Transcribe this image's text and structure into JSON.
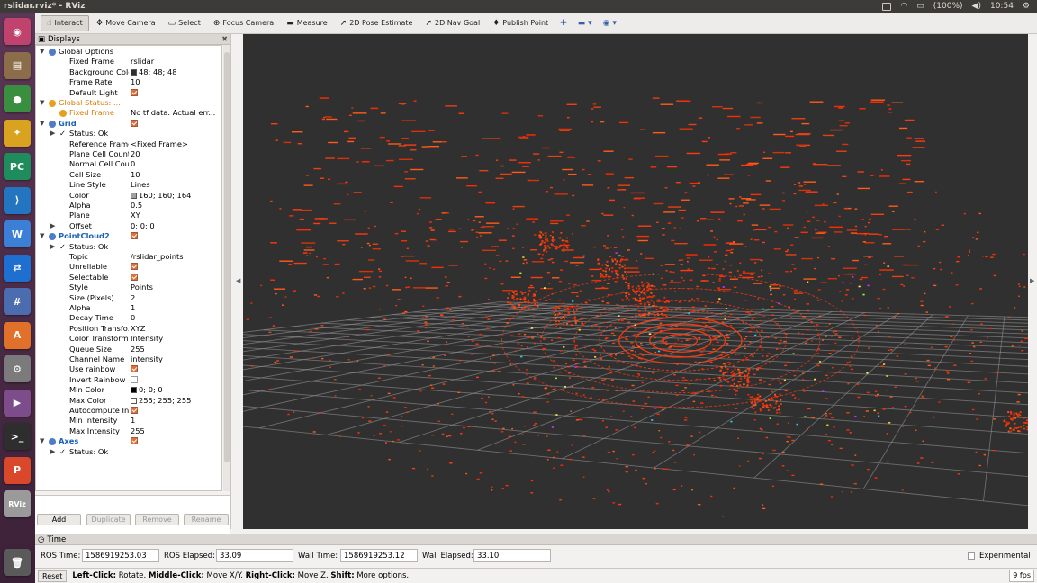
{
  "window": {
    "title": "rslidar.rviz* - RViz"
  },
  "system": {
    "battery": "(100%)",
    "time": "10:54"
  },
  "launcher": [
    {
      "name": "ubuntu-dash",
      "glyph": "◉",
      "color": "#c0436e"
    },
    {
      "name": "files",
      "glyph": "▤",
      "color": "#8c6d4a"
    },
    {
      "name": "chrome",
      "glyph": "●",
      "color": "#3a8e3f"
    },
    {
      "name": "inkscape",
      "glyph": "✦",
      "color": "#d9a31f"
    },
    {
      "name": "pycharm",
      "glyph": "PC",
      "color": "#1f8c5c"
    },
    {
      "name": "vscode",
      "glyph": "⟩",
      "color": "#2475c1"
    },
    {
      "name": "wps-writer",
      "glyph": "W",
      "color": "#3b7fd6"
    },
    {
      "name": "teamviewer",
      "glyph": "⇄",
      "color": "#1f6fd1"
    },
    {
      "name": "monodevelop",
      "glyph": "#",
      "color": "#4b6db0"
    },
    {
      "name": "software-center",
      "glyph": "A",
      "color": "#e0702a"
    },
    {
      "name": "system-settings",
      "glyph": "⚙",
      "color": "#7b7b7b"
    },
    {
      "name": "video-player",
      "glyph": "▶",
      "color": "#7d4d8b"
    },
    {
      "name": "terminal",
      "glyph": ">_",
      "color": "#2e2e2e"
    },
    {
      "name": "wps-presentation",
      "glyph": "P",
      "color": "#d9482b"
    },
    {
      "name": "rviz",
      "glyph": "RViz",
      "color": "#9a9a9a"
    },
    {
      "name": "trash",
      "glyph": "🗑",
      "color": "#5a5a5a"
    }
  ],
  "toolbar": {
    "tools": [
      {
        "id": "interact",
        "label": "Interact",
        "icon": "☝",
        "active": true
      },
      {
        "id": "move-camera",
        "label": "Move Camera",
        "icon": "✥",
        "active": false
      },
      {
        "id": "select",
        "label": "Select",
        "icon": "▭",
        "active": false
      },
      {
        "id": "focus-camera",
        "label": "Focus Camera",
        "icon": "⊕",
        "active": false
      },
      {
        "id": "measure",
        "label": "Measure",
        "icon": "▬",
        "active": false
      },
      {
        "id": "2d-pose-estimate",
        "label": "2D Pose Estimate",
        "icon": "➚",
        "active": false
      },
      {
        "id": "2d-nav-goal",
        "label": "2D Nav Goal",
        "icon": "➚",
        "active": false
      },
      {
        "id": "publish-point",
        "label": "Publish Point",
        "icon": "♦",
        "active": false
      }
    ]
  },
  "displays": {
    "title": "Displays",
    "rows": [
      {
        "depth": 1,
        "arrow": "▼",
        "label": "Global Options",
        "icon": "#4f7cc4",
        "kind": "group-plain"
      },
      {
        "depth": 2,
        "label": "Fixed Frame",
        "value": "rslidar"
      },
      {
        "depth": 2,
        "label": "Background Color",
        "value": "48; 48; 48",
        "swatch": "#303030"
      },
      {
        "depth": 2,
        "label": "Frame Rate",
        "value": "10"
      },
      {
        "depth": 2,
        "label": "Default Light",
        "check": true
      },
      {
        "depth": 1,
        "arrow": "▼",
        "label": "Global Status: ...",
        "icon": "#e6a01c",
        "kind": "warn"
      },
      {
        "depth": 2,
        "label": "Fixed Frame",
        "value": "No tf data.  Actual err...",
        "icon": "#e6a01c",
        "kind": "warn"
      },
      {
        "depth": 1,
        "arrow": "▼",
        "label": "Grid",
        "icon": "#4f7cc4",
        "kind": "group",
        "check": true
      },
      {
        "depth": 2,
        "arrow": "▶",
        "label": "Status: Ok",
        "tick": true
      },
      {
        "depth": 2,
        "label": "Reference Frame",
        "value": "<Fixed Frame>"
      },
      {
        "depth": 2,
        "label": "Plane Cell Count",
        "value": "20"
      },
      {
        "depth": 2,
        "label": "Normal Cell Count",
        "value": "0"
      },
      {
        "depth": 2,
        "label": "Cell Size",
        "value": "10"
      },
      {
        "depth": 2,
        "label": "Line Style",
        "value": "Lines"
      },
      {
        "depth": 2,
        "label": "Color",
        "value": "160; 160; 164",
        "swatch": "#a0a0a4"
      },
      {
        "depth": 2,
        "label": "Alpha",
        "value": "0.5"
      },
      {
        "depth": 2,
        "label": "Plane",
        "value": "XY"
      },
      {
        "depth": 2,
        "arrow": "▶",
        "label": "Offset",
        "value": "0; 0; 0"
      },
      {
        "depth": 1,
        "arrow": "▼",
        "label": "PointCloud2",
        "icon": "#4f7cc4",
        "kind": "group",
        "check": true
      },
      {
        "depth": 2,
        "arrow": "▶",
        "label": "Status: Ok",
        "tick": true
      },
      {
        "depth": 2,
        "label": "Topic",
        "value": "/rslidar_points"
      },
      {
        "depth": 2,
        "label": "Unreliable",
        "check": true
      },
      {
        "depth": 2,
        "label": "Selectable",
        "check": true
      },
      {
        "depth": 2,
        "label": "Style",
        "value": "Points"
      },
      {
        "depth": 2,
        "label": "Size (Pixels)",
        "value": "2"
      },
      {
        "depth": 2,
        "label": "Alpha",
        "value": "1"
      },
      {
        "depth": 2,
        "label": "Decay Time",
        "value": "0"
      },
      {
        "depth": 2,
        "label": "Position Transfo...",
        "value": "XYZ"
      },
      {
        "depth": 2,
        "label": "Color Transformer",
        "value": "Intensity"
      },
      {
        "depth": 2,
        "label": "Queue Size",
        "value": "255"
      },
      {
        "depth": 2,
        "label": "Channel Name",
        "value": "intensity"
      },
      {
        "depth": 2,
        "label": "Use rainbow",
        "check": true
      },
      {
        "depth": 2,
        "label": "Invert Rainbow",
        "check": false
      },
      {
        "depth": 2,
        "label": "Min Color",
        "value": "0; 0; 0",
        "swatch": "#000000"
      },
      {
        "depth": 2,
        "label": "Max Color",
        "value": "255; 255; 255",
        "swatch": "#ffffff"
      },
      {
        "depth": 2,
        "label": "Autocompute In...",
        "check": true
      },
      {
        "depth": 2,
        "label": "Min Intensity",
        "value": "1"
      },
      {
        "depth": 2,
        "label": "Max Intensity",
        "value": "255"
      },
      {
        "depth": 1,
        "arrow": "▼",
        "label": "Axes",
        "icon": "#4f7cc4",
        "kind": "group",
        "check": true
      },
      {
        "depth": 2,
        "arrow": "▶",
        "label": "Status: Ok",
        "tick": true
      }
    ],
    "buttons": {
      "add": "Add",
      "duplicate": "Duplicate",
      "remove": "Remove",
      "rename": "Rename"
    }
  },
  "time": {
    "title": "Time",
    "ros_time_label": "ROS Time:",
    "ros_time": "1586919253.03",
    "ros_elapsed_label": "ROS Elapsed:",
    "ros_elapsed": "33.09",
    "wall_time_label": "Wall Time:",
    "wall_time": "1586919253.12",
    "wall_elapsed_label": "Wall Elapsed:",
    "wall_elapsed": "33.10",
    "experimental_label": "Experimental"
  },
  "status": {
    "reset": "Reset",
    "hint_left": "Left-Click:",
    "hint_left_text": " Rotate. ",
    "hint_middle": "Middle-Click:",
    "hint_middle_text": " Move X/Y. ",
    "hint_right": "Right-Click:",
    "hint_right_text": " Move Z. ",
    "hint_shift": "Shift:",
    "hint_shift_text": " More options.",
    "fps": "9 fps"
  },
  "colors": {
    "viewport_bg": "#303030",
    "points": "#ff3a10",
    "grid": "#a0a0a4"
  }
}
